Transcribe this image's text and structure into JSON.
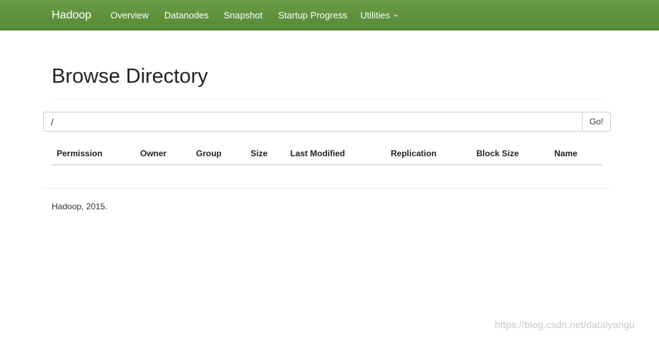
{
  "navbar": {
    "brand": "Hadoop",
    "items": [
      {
        "label": "Overview"
      },
      {
        "label": "Datanodes"
      },
      {
        "label": "Snapshot"
      },
      {
        "label": "Startup Progress"
      },
      {
        "label": "Utilities"
      }
    ],
    "colors": {
      "background": "#5e9140",
      "text": "#ffffff"
    }
  },
  "main": {
    "title": "Browse Directory",
    "path_input": {
      "value": "/"
    },
    "go_button_label": "Go!",
    "table": {
      "columns": [
        "Permission",
        "Owner",
        "Group",
        "Size",
        "Last Modified",
        "Replication",
        "Block Size",
        "Name"
      ],
      "rows": []
    }
  },
  "footer": {
    "text": "Hadoop, 2015."
  },
  "watermark": "https://blog.csdn.net/datalyangu"
}
